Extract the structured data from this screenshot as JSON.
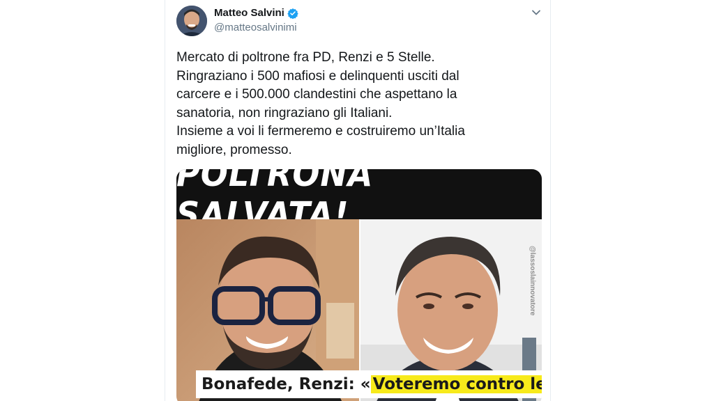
{
  "author": {
    "name": "Matteo Salvini",
    "handle": "@matteosalvinimi",
    "verified": true
  },
  "icons": {
    "verified": "verified-badge-icon",
    "menu": "chevron-down-icon"
  },
  "tweet": {
    "lines": [
      "Mercato di poltrone fra PD, Renzi e 5 Stelle.",
      "Ringraziano i 500 mafiosi e delinquenti usciti dal",
      "carcere e i 500.000 clandestini che aspettano la",
      "sanatoria, non ringraziano gli Italiani.",
      "Insieme a voi li fermeremo e costruiremo un’Italia",
      "migliore, promesso."
    ]
  },
  "media": {
    "headline": "POLTRONA SALVATA!",
    "caption_prefix": "Bonafede, Renzi: «",
    "caption_highlight": "Voteremo contro le",
    "watermark": "@lassoslainnovatore"
  },
  "colors": {
    "verified": "#1da1f2",
    "highlight": "#f7ea1b",
    "headline_bg": "#111111"
  }
}
